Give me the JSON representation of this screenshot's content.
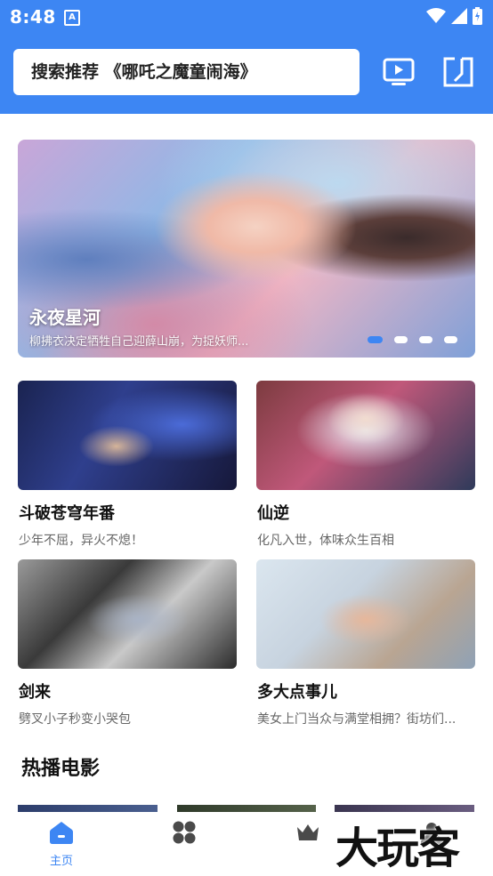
{
  "status_bar": {
    "time": "8:48",
    "notification_icon": "A"
  },
  "header": {
    "search_text": "搜索推荐 《哪吒之魔童闹海》",
    "tv_button_icon": "tv-icon",
    "history_button_icon": "history-icon"
  },
  "banner": {
    "title": "永夜星河",
    "subtitle": "柳拂衣决定牺牲自己迎薛山崩，为捉妖师...",
    "active_dot": 0,
    "dot_count": 4
  },
  "cards": [
    {
      "title": "斗破苍穹年番",
      "desc": "少年不屈，异火不熄！"
    },
    {
      "title": "仙逆",
      "desc": "化凡入世，体味众生百相"
    },
    {
      "title": "剑来",
      "desc": "劈叉小子秒变小哭包"
    },
    {
      "title": "多大点事儿",
      "desc": "美女上门当众与满堂相拥？街坊们..."
    }
  ],
  "section": {
    "title": "热播电影"
  },
  "nav": [
    {
      "label": "主页",
      "icon": "home-icon",
      "active": true
    },
    {
      "label": "",
      "icon": "grid-icon",
      "active": false
    },
    {
      "label": "",
      "icon": "crown-icon",
      "active": false
    },
    {
      "label": "",
      "icon": "profile-icon",
      "active": false
    }
  ],
  "watermark": "大玩客",
  "colors": {
    "accent": "#3d86f3"
  }
}
